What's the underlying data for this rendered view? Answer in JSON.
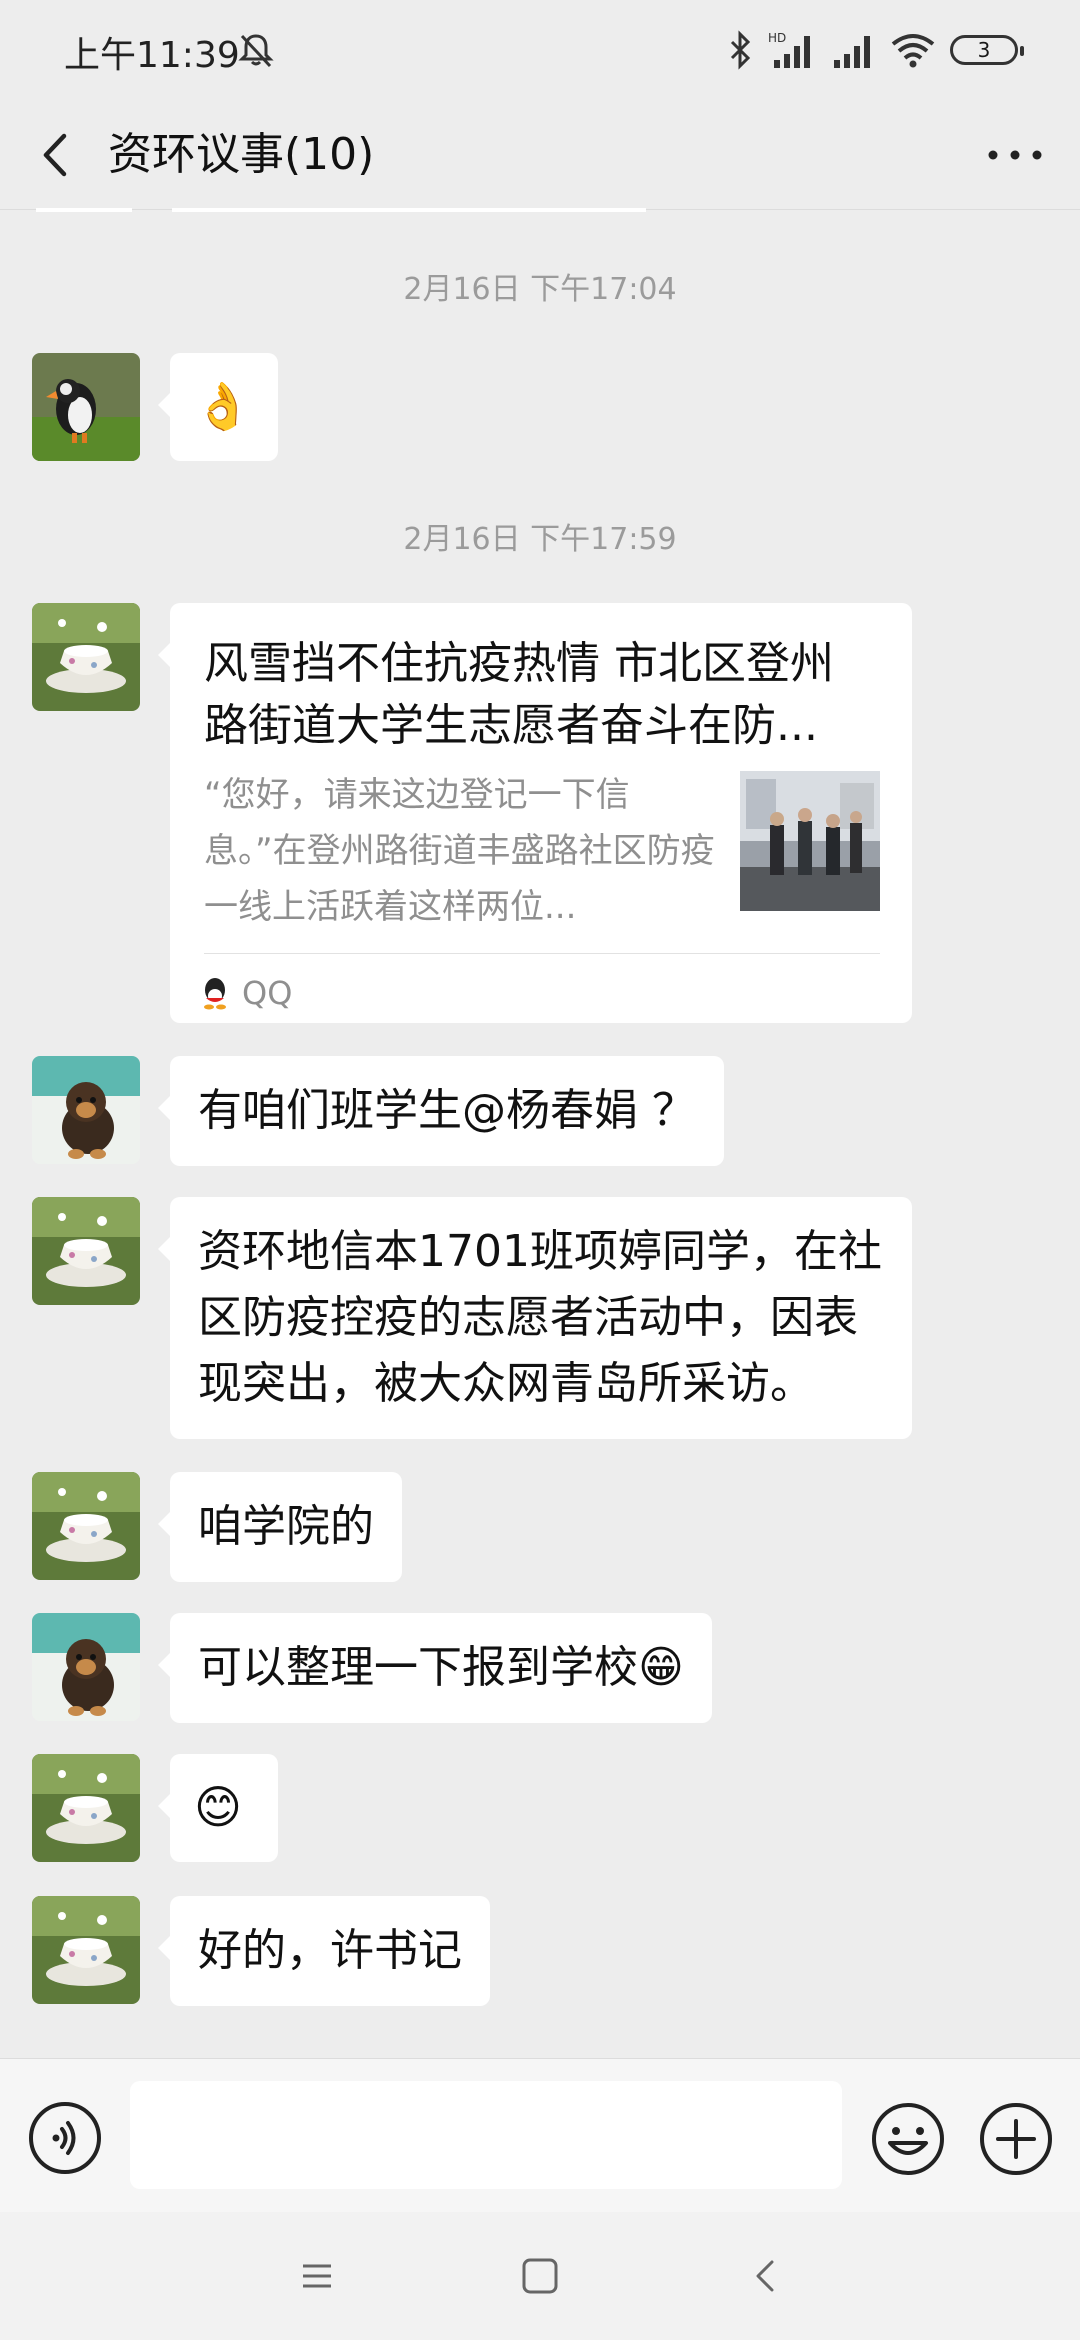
{
  "status": {
    "time": "上午11:39",
    "battery": "3",
    "network": "HD"
  },
  "header": {
    "title": "资环议事(10)"
  },
  "timestamps": [
    "2月16日 下午17:04",
    "2月16日 下午17:59"
  ],
  "messages": [
    {
      "sender_avatar": "puffin",
      "text": "👌"
    },
    {
      "sender_avatar": "teacup",
      "type": "link",
      "title": "风雪挡不住抗疫热情 市北区登州路街道大学生志愿者奋斗在防...",
      "desc": "“您好，请来这边登记一下信息。”在登州路街道丰盛路社区防疫一线上活跃着这样两位...",
      "source": "QQ"
    },
    {
      "sender_avatar": "dog",
      "text": "有咱们班学生@杨春娟 ？"
    },
    {
      "sender_avatar": "teacup",
      "text": "资环地信本1701班项婷同学，在社区防疫控疫的志愿者活动中，因表现突出，被大众网青岛所采访。"
    },
    {
      "sender_avatar": "teacup",
      "text": "咱学院的"
    },
    {
      "sender_avatar": "dog",
      "text": "可以整理一下报到学校😁"
    },
    {
      "sender_avatar": "teacup",
      "text": "😊"
    },
    {
      "sender_avatar": "teacup",
      "text": "好的，许书记"
    }
  ],
  "input": {
    "value": ""
  },
  "icons": {
    "back": "back-arrow-icon",
    "more": "more-icon",
    "voice": "voice-icon",
    "emoji": "emoji-icon",
    "plus": "plus-icon",
    "mute": "mute-bell-icon"
  },
  "colors": {
    "background": "#ededed",
    "bubble": "#ffffff",
    "timestamp": "#9b9b9b"
  }
}
